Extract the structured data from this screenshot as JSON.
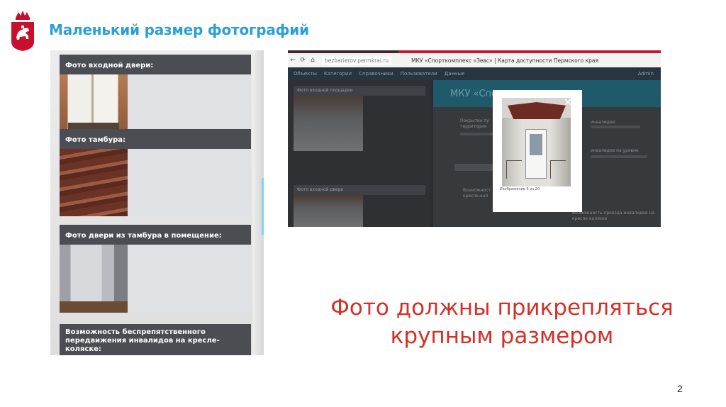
{
  "slide": {
    "title": "Маленький размер фотографий",
    "note": "Фото должны прикрепляться крупным размером",
    "page_number": "2"
  },
  "left_screenshot": {
    "cards": [
      {
        "label": "Фото входной двери:"
      },
      {
        "label": "Фото тамбура:"
      },
      {
        "label": "Фото двери из тамбура в помещение:"
      },
      {
        "label": "Возможность беспрепятственного передвижения инвалидов на кресле-коляске:"
      }
    ]
  },
  "right_screenshot": {
    "url": "bezbarierov.permkrai.ru",
    "page_title": "МКУ «Спорткомплекс «Зевс» | Карта доступности Пермского края",
    "nav": [
      "Объекты",
      "Категории",
      "Справочники",
      "Пользователи",
      "Данные"
    ],
    "admin": "Admin",
    "left_cards": [
      "Фото входной площадки",
      "Фото входной двери"
    ],
    "banner": "МКУ «Спо",
    "lightbox_caption": "Изображение 6 из 20",
    "bg_texts": [
      "Покрытие пу территория",
      "Возможност кресле-кол",
      "инвалидов:",
      "инвалидов на уровне",
      "Возможность проезда инвалидов на кресле-коляске"
    ]
  },
  "colors": {
    "title": "#2a9fd6",
    "note": "#d62f26",
    "card_header": "#4b4d52"
  }
}
